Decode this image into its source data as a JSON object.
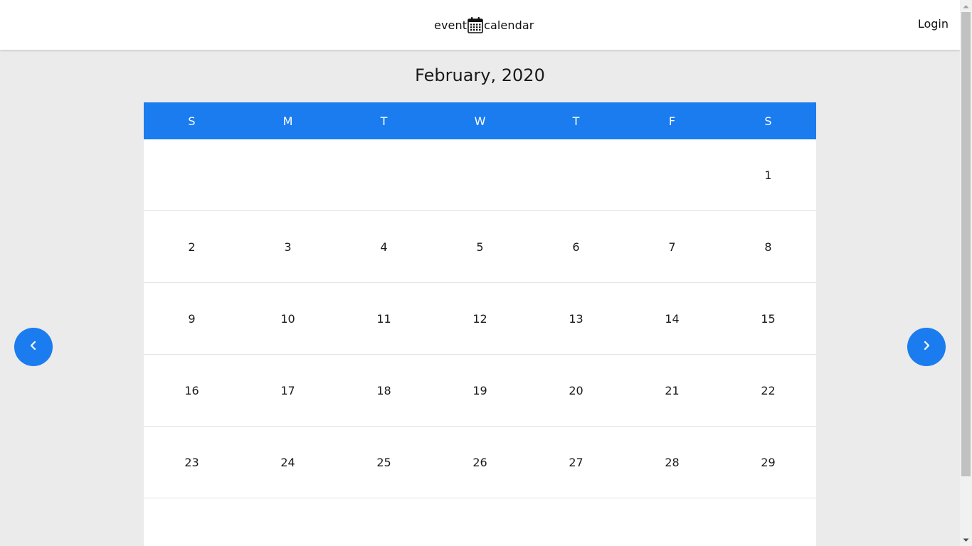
{
  "header": {
    "logo_left": "event",
    "logo_right": "calendar",
    "logo_icon": "calendar-icon",
    "login_label": "Login"
  },
  "calendar": {
    "month_title": "February, 2020",
    "weekdays": [
      "S",
      "M",
      "T",
      "W",
      "T",
      "F",
      "S"
    ],
    "weeks": [
      [
        "",
        "",
        "",
        "",
        "",
        "",
        "1"
      ],
      [
        "2",
        "3",
        "4",
        "5",
        "6",
        "7",
        "8"
      ],
      [
        "9",
        "10",
        "11",
        "12",
        "13",
        "14",
        "15"
      ],
      [
        "16",
        "17",
        "18",
        "19",
        "20",
        "21",
        "22"
      ],
      [
        "23",
        "24",
        "25",
        "26",
        "27",
        "28",
        "29"
      ],
      [
        "",
        "",
        "",
        "",
        "",
        "",
        ""
      ]
    ]
  },
  "navigation": {
    "prev_icon": "chevron-left-icon",
    "next_icon": "chevron-right-icon"
  },
  "colors": {
    "accent": "#1a7cef",
    "background": "#ebebeb",
    "surface": "#ffffff"
  }
}
